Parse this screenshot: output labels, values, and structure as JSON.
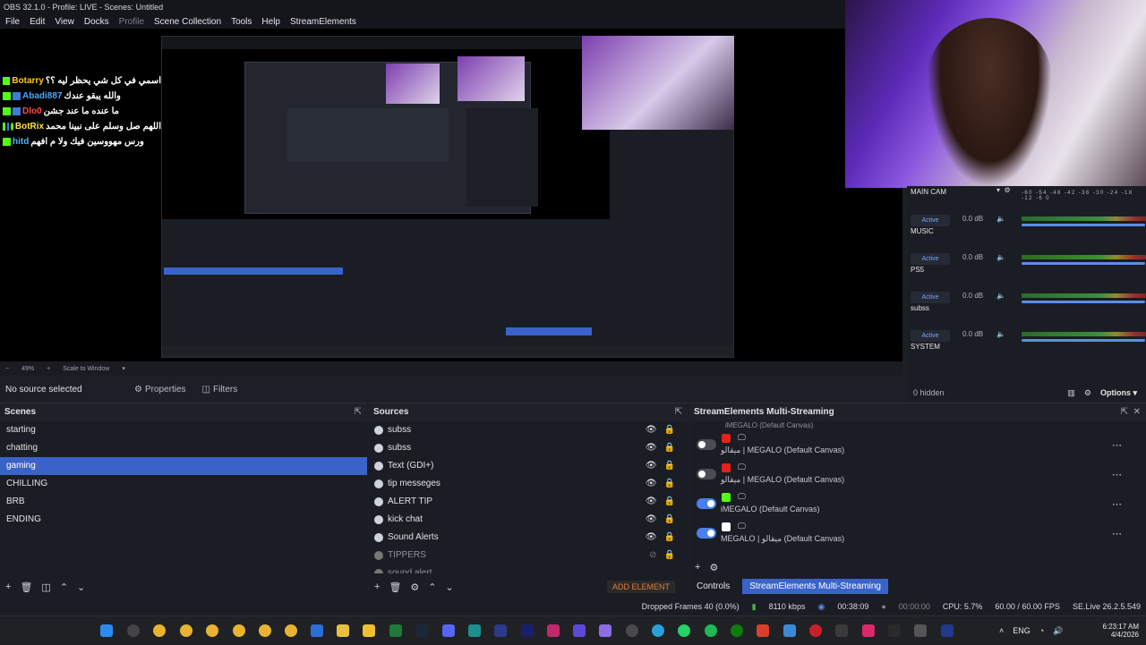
{
  "window": {
    "title": "OBS 32.1.0 - Profile: LIVE - Scenes: Untitled"
  },
  "menu": [
    "File",
    "Edit",
    "View",
    "Docks",
    "Profile",
    "Scene Collection",
    "Tools",
    "Help",
    "StreamElements"
  ],
  "chat": [
    {
      "name": "Botarry",
      "message": "اسمي في كل شي يحظر ليه ؟؟",
      "color": "#ffc81e"
    },
    {
      "name": "Abadi887",
      "message": "والله يبقو عندك",
      "color": "#4aa7ff"
    },
    {
      "name": "Dlo0",
      "message": "ما عنده ما عند جشن",
      "color": "#ff4a4a"
    },
    {
      "name": "BotRix",
      "message": "اللهم صل وسلم على نبينا محمد",
      "color": "#ffe24a"
    },
    {
      "name": "hitd",
      "message": "ورس مهووسين فيك ولا م افهم",
      "color": "#4ab4ff"
    }
  ],
  "preview": {
    "zoom": "49%",
    "scale_mode": "Scale to Window"
  },
  "context_bar": {
    "no_source": "No source selected",
    "properties": "Properties",
    "filters": "Filters"
  },
  "mixer": {
    "channels": [
      {
        "name": "MAIN CAM",
        "db": "",
        "state": ""
      },
      {
        "name": "MUSIC",
        "db": "0.0 dB",
        "state": "Active"
      },
      {
        "name": "PS5",
        "db": "0.0 dB",
        "state": "Active"
      },
      {
        "name": "subss",
        "db": "0.0 dB",
        "state": "Active"
      },
      {
        "name": "SYSTEM",
        "db": "0.0 dB",
        "state": "Active"
      }
    ],
    "ticks": "-60 -54 -48 -42 -36 -30 -24 -18 -12 -6 0",
    "hidden": "0 hidden",
    "options": "Options"
  },
  "scenes": {
    "title": "Scenes",
    "items": [
      "starting",
      "chatting",
      "gaming",
      "CHILLING",
      "BRB",
      "ENDING"
    ],
    "selected": 2
  },
  "sources": {
    "title": "Sources",
    "items": [
      {
        "name": "subss",
        "dim": false
      },
      {
        "name": "subss",
        "dim": false
      },
      {
        "name": "Text (GDI+)",
        "dim": false
      },
      {
        "name": "tip messeges",
        "dim": false
      },
      {
        "name": "ALERT TIP",
        "dim": false
      },
      {
        "name": "kick chat",
        "dim": false
      },
      {
        "name": "Sound Alerts",
        "dim": false
      },
      {
        "name": "TIPPERS",
        "dim": true
      },
      {
        "name": "sound alert",
        "dim": true
      }
    ],
    "add_element": "ADD ELEMENT"
  },
  "multistream": {
    "title": "StreamElements Multi-Streaming",
    "top_partial": "iMEGALO (Default Canvas)",
    "destinations": [
      {
        "label": "ميقالو | MEGALO (Default Canvas)",
        "platform": "youtube",
        "on": false,
        "color": "#e62117"
      },
      {
        "label": "ميقالو | MEGALO (Default Canvas)",
        "platform": "youtube",
        "on": false,
        "color": "#e62117"
      },
      {
        "label": "iMEGALO (Default Canvas)",
        "platform": "kick",
        "on": true,
        "color": "#53fc18"
      },
      {
        "label": "MEGALO | ميقالو (Default Canvas)",
        "platform": "tiktok",
        "on": true,
        "color": "#ffffff"
      }
    ],
    "tab_controls": "Controls",
    "tab_multistream": "StreamElements Multi-Streaming"
  },
  "status": {
    "dropped": "Dropped Frames 40 (0.0%)",
    "kbps": "8110 kbps",
    "live_time": "00:38:09",
    "rec_time": "00:00:00",
    "cpu": "CPU: 5.7%",
    "fps": "60.00 / 60.00 FPS",
    "version": "SE.Live 26.2.5.549"
  },
  "taskbar": {
    "lang": "ENG",
    "time": "6:23:17 AM",
    "date": "4/4/2026"
  }
}
